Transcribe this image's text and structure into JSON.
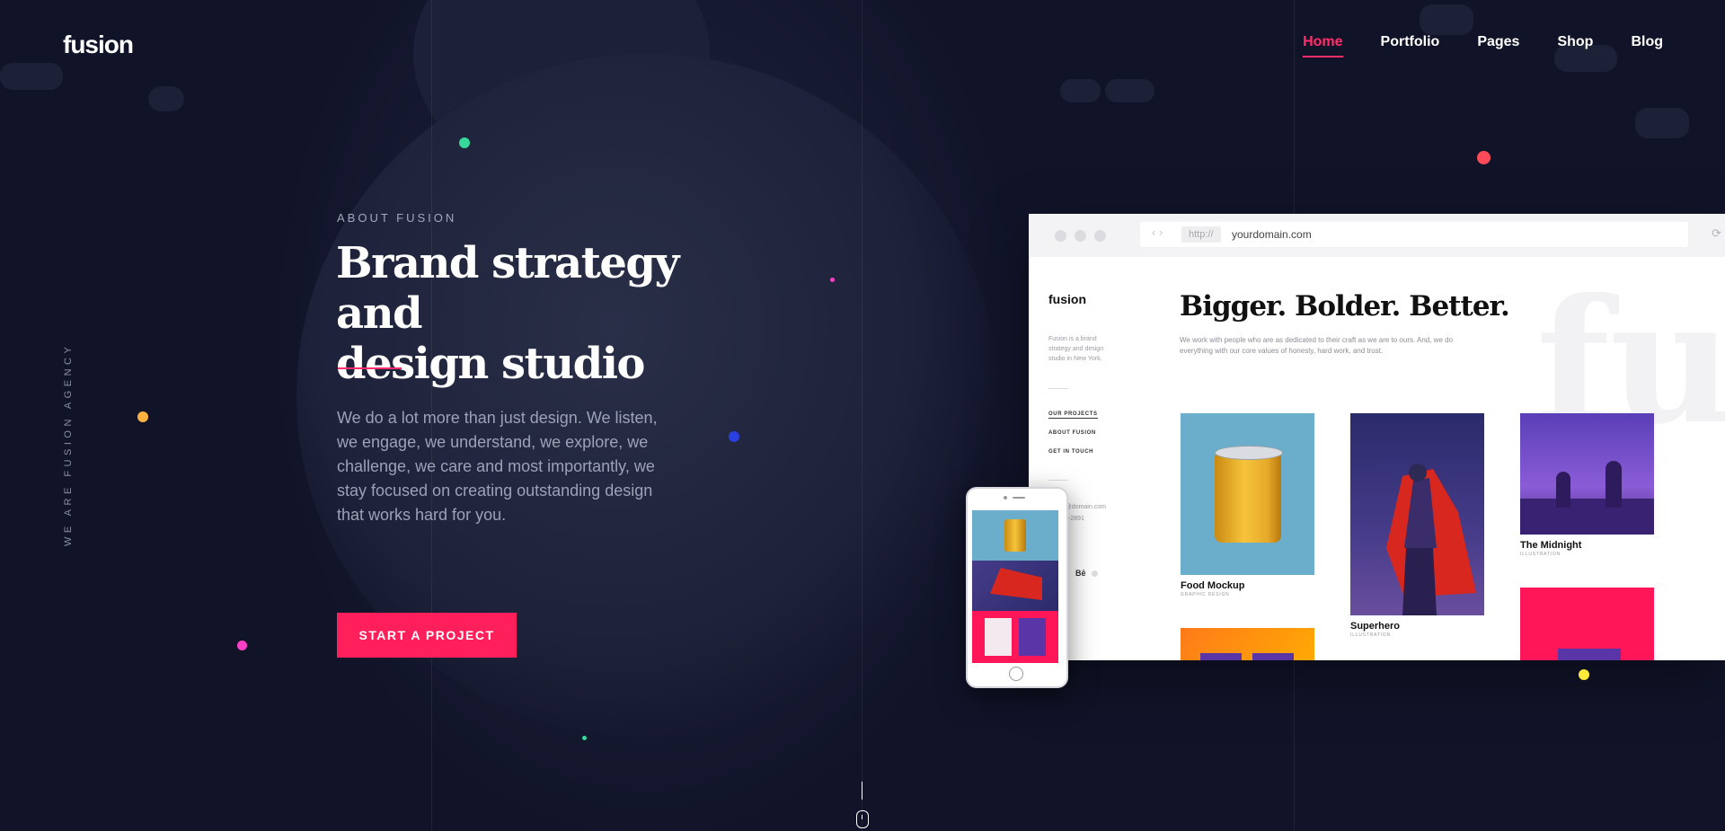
{
  "brand": {
    "logo": "fusion"
  },
  "nav": {
    "items": [
      {
        "label": "Home",
        "active": true
      },
      {
        "label": "Portfolio",
        "active": false
      },
      {
        "label": "Pages",
        "active": false
      },
      {
        "label": "Shop",
        "active": false
      },
      {
        "label": "Blog",
        "active": false
      }
    ]
  },
  "side_text": "WE ARE FUSION AGENCY",
  "hero": {
    "eyebrow": "ABOUT FUSION",
    "headline_line1": "Brand strategy and",
    "headline_line2": "design studio",
    "body": "We do a lot more than just design. We listen, we engage, we understand, we explore, we challenge, we care and most importantly, we stay focused on creating outstanding design that works hard for you.",
    "cta_label": "START A PROJECT"
  },
  "browser": {
    "protocol": "http://",
    "domain": "yourdomain.com",
    "logo": "fusion",
    "about": "Fusion is a brand strategy and design studio in New York.",
    "nav": [
      "OUR PROJECTS",
      "ABOUT FUSION",
      "GET IN TOUCH"
    ],
    "email": "fusion@domain.com",
    "phone": "+1-404-2891",
    "social": "Bē",
    "watermark": "fu",
    "title": "Bigger. Bolder. Better.",
    "subtitle": "We work with people who are as dedicated to their craft as we are to ours. And, we do everything with our core values of honesty, hard work, and trust.",
    "projects": [
      {
        "name": "Food Mockup",
        "category": "GRAPHIC DESIGN"
      },
      {
        "name": "Superhero",
        "category": "ILLUSTRATION"
      },
      {
        "name": "The Midnight",
        "category": "ILLUSTRATION"
      }
    ]
  },
  "colors": {
    "background": "#121630",
    "accent": "#ff1f5a",
    "dot_green": "#36d89b",
    "dot_red": "#ff4a5a",
    "dot_orange": "#ffb23f",
    "dot_blue": "#2a3fe0",
    "dot_pink": "#ff3fc8",
    "dot_yellow": "#ffe93a"
  }
}
